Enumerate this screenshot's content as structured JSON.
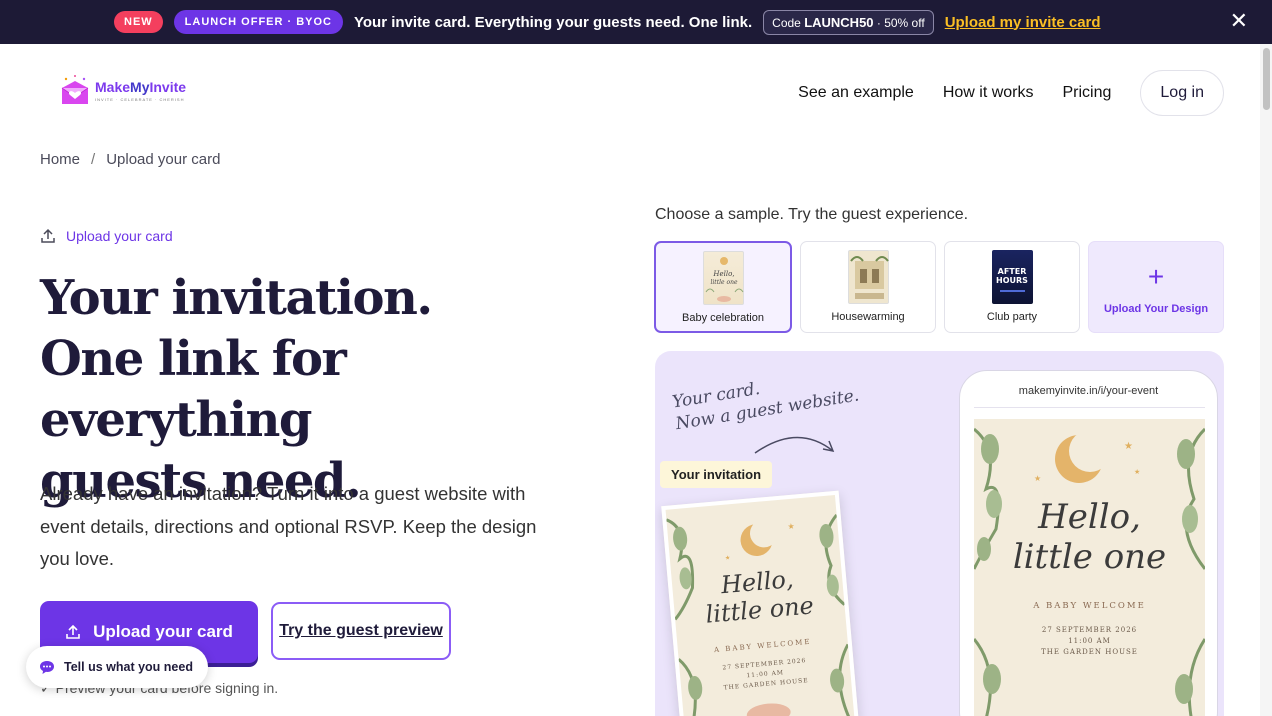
{
  "banner": {
    "new_label": "NEW",
    "offer_label": "LAUNCH OFFER · BYOC",
    "message": "Your invite card. Everything your guests need. One link.",
    "code_prefix": "Code",
    "code": "LAUNCH50",
    "code_suffix": "· 50% off",
    "cta": "Upload my invite card",
    "close_icon": "close-icon"
  },
  "header": {
    "logo_name_a": "Make",
    "logo_name_b": "My",
    "logo_name_c": "Invite",
    "logo_tagline": "INVITE · CELEBRATE · CHERISH",
    "nav": [
      "See an example",
      "How it works",
      "Pricing"
    ],
    "login": "Log in"
  },
  "breadcrumb": {
    "home": "Home",
    "separator": "/",
    "current": "Upload your card"
  },
  "hero": {
    "tag": "Upload your card",
    "title_line1": "Your invitation.",
    "title_line2": "One link for everything",
    "title_line3": "guests need.",
    "subtitle": "Already have an invitation? Turn it into a guest website with event details, directions and optional RSVP. Keep the design you love.",
    "primary_button": "Upload your card",
    "secondary_button": "Try the guest preview",
    "footnote": "✓ Preview your card before signing in."
  },
  "chat": {
    "label": "Tell us what you need"
  },
  "samples": {
    "heading": "Choose a sample. Try the guest experience.",
    "items": [
      {
        "label": "Baby celebration",
        "selected": true
      },
      {
        "label": "Housewarming",
        "selected": false
      },
      {
        "label": "Club party",
        "selected": false
      }
    ],
    "upload_label": "Upload Your Design",
    "upload_icon": "+"
  },
  "preview": {
    "script_line1": "Your card.",
    "script_line2": "Now a guest website.",
    "invitation_tag": "Your invitation",
    "phone_url": "makemyinvite.in/i/your-event",
    "card": {
      "line1": "Hello,",
      "line2": "little one",
      "subtitle": "A BABY WELCOME",
      "date": "27 SEPTEMBER 2026",
      "time": "11:00 AM",
      "venue": "THE GARDEN HOUSE"
    }
  },
  "colors": {
    "brand_purple": "#6d35e6",
    "banner_bg": "#1d1a36",
    "new_pill": "#f43f5e",
    "banner_link": "#fbbf24",
    "preview_bg": "#ebe4fb"
  }
}
